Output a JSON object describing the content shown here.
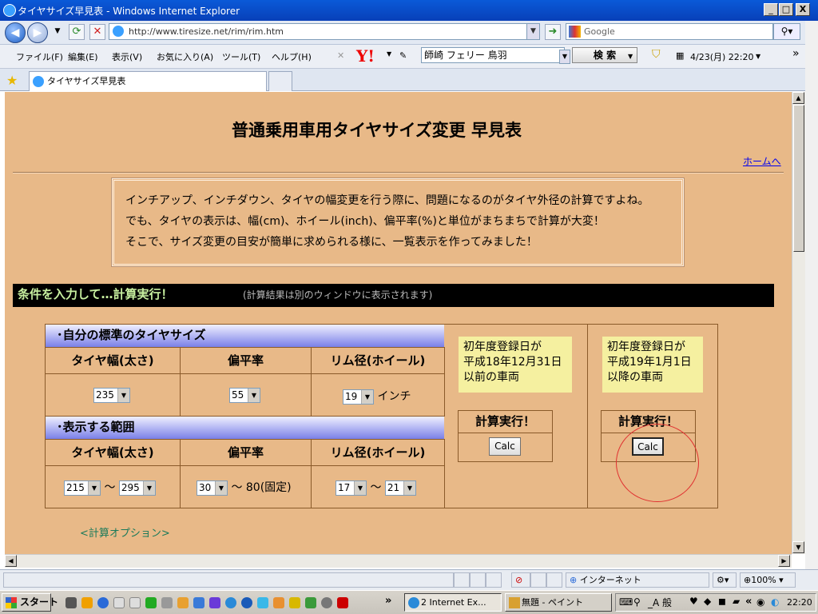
{
  "window": {
    "title": "タイヤサイズ早見表 - Windows Internet Explorer",
    "min": "_",
    "max": "□",
    "close": "X"
  },
  "address": {
    "url": "http://www.tiresize.net/rim/rim.htm",
    "search_placeholder": "Google"
  },
  "menu": {
    "items": [
      "ファイル(F)",
      "編集(E)",
      "表示(V)",
      "お気に入り(A)",
      "ツール(T)",
      "ヘルプ(H)"
    ],
    "yahoo_logo": "Y!",
    "search_text": "師崎 フェリー 鳥羽",
    "search_button": "検 索",
    "date": "4/23(月) 22:20",
    "overflow": "»"
  },
  "tabs": {
    "active": "タイヤサイズ早見表"
  },
  "page": {
    "title": "普通乗用車用タイヤサイズ変更 早見表",
    "home_link": "ホームへ",
    "intro": [
      "インチアップ、インチダウン、タイヤの幅変更を行う際に、問題になるのがタイヤ外径の計算ですよね。",
      "でも、タイヤの表示は、幅(cm)、ホイール(inch)、偏平率(%)と単位がまちまちで計算が大変！",
      "そこで、サイズ変更の目安が簡単に求められる様に、一覧表示を作ってみました！"
    ],
    "banner": "条件を入力して…計算実行！",
    "banner_note": "(計算結果は別のウィンドウに表示されます)",
    "section1": "･自分の標準のタイヤサイズ",
    "section2": "･表示する範囲",
    "col_width": "タイヤ幅(太さ)",
    "col_aspect": "偏平率",
    "col_rim": "リム径(ホイール)",
    "std_width": "235",
    "std_aspect": "55",
    "std_rim": "19",
    "inch_unit": "インチ",
    "range_width_from": "215",
    "range_width_to": "295",
    "range_aspect_from": "30",
    "range_aspect_fixed": "～ 80(固定)",
    "range_rim_from": "17",
    "range_rim_to": "21",
    "tilde": "～",
    "left_note": [
      "初年度登録日が",
      "平成18年12月31日",
      "以前の車両"
    ],
    "right_note": [
      "初年度登録日が",
      "平成19年1月1日",
      "以降の車両"
    ],
    "calc_header": "計算実行！",
    "calc_button": "Calc",
    "calc_option": "<計算オプション>"
  },
  "status": {
    "zone": "インターネット",
    "zoom": "100%"
  },
  "taskbar": {
    "start": "スタート",
    "task1": "2 Internet Ex...",
    "task2": "無題 - ペイント",
    "clock": "22:20",
    "overflow": "»",
    "tray_overflow": "«",
    "tray_ime": "_A 般"
  }
}
